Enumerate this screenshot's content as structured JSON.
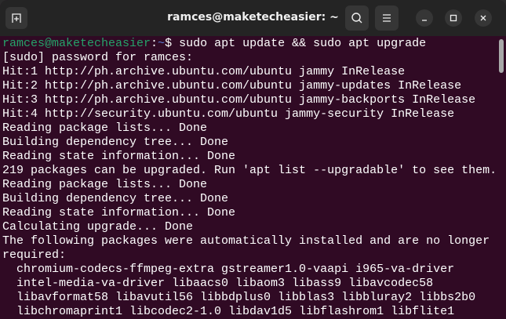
{
  "window": {
    "title": "ramces@maketecheasier: ~"
  },
  "titlebar": {
    "icons": [
      "new-tab-icon",
      "search-icon",
      "menu-icon",
      "minimize-icon",
      "maximize-icon",
      "close-icon"
    ]
  },
  "prompt": {
    "user_host": "ramces@maketecheasier",
    "sep": ":",
    "path": "~",
    "symbol": "$",
    "command": " sudo apt update && sudo apt upgrade"
  },
  "output": [
    "[sudo] password for ramces:",
    "Hit:1 http://ph.archive.ubuntu.com/ubuntu jammy InRelease",
    "Hit:2 http://ph.archive.ubuntu.com/ubuntu jammy-updates InRelease",
    "Hit:3 http://ph.archive.ubuntu.com/ubuntu jammy-backports InRelease",
    "Hit:4 http://security.ubuntu.com/ubuntu jammy-security InRelease",
    "Reading package lists... Done",
    "Building dependency tree... Done",
    "Reading state information... Done",
    "219 packages can be upgraded. Run 'apt list --upgradable' to see them.",
    "Reading package lists... Done",
    "Building dependency tree... Done",
    "Reading state information... Done",
    "Calculating upgrade... Done",
    "The following packages were automatically installed and are no longer",
    "required:",
    "  chromium-codecs-ffmpeg-extra gstreamer1.0-vaapi i965-va-driver",
    "  intel-media-va-driver libaacs0 libaom3 libass9 libavcodec58",
    "  libavformat58 libavutil56 libbdplus0 libblas3 libbluray2 libbs2b0",
    "  libchromaprint1 libcodec2-1.0 libdav1d5 libflashrom1 libflite1"
  ],
  "scrollbar": {
    "position_fraction": 0.0,
    "thumb_fraction": 0.12
  },
  "colors": {
    "background": "#300a24",
    "prompt_user": "#26a269",
    "prompt_path": "#5b7bd5",
    "titlebar": "#242424"
  }
}
